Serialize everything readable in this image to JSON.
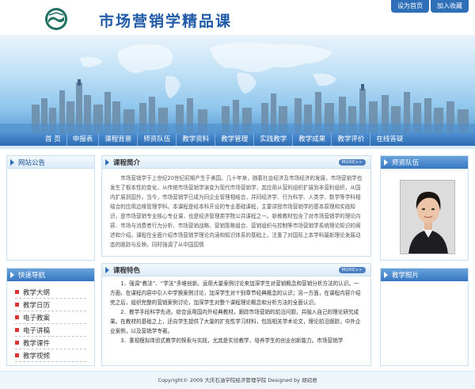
{
  "header": {
    "title": "市场营销学精品课",
    "links": [
      "设为首页",
      "加入收藏"
    ]
  },
  "nav": {
    "items": [
      "首 页",
      "申报表",
      "课程背景",
      "师资队伍",
      "教学资料",
      "教学管理",
      "实践教学",
      "教学成果",
      "教学评价",
      "在线答疑"
    ]
  },
  "left": {
    "announcement_title": "网站公告",
    "quicknav_title": "快速导航",
    "quicknav_items": [
      "教学大纲",
      "教学日历",
      "电子教案",
      "电子讲稿",
      "教学课件",
      "教学视频"
    ]
  },
  "main": {
    "intro_title": "课程简介",
    "intro_more": "MORE>>",
    "intro_text": "市场营销学于上世纪20世纪初期产生于美国。几十年来，随着社会经济及市场经济的发展，市场营销学也发生了根本性的变化，从传统市场营销学演变为现代市场营销学，其应用从营利组织扩展到非营利组织，从国内扩展到国外。当今，市场营销学已成为同企业管理相结合，并同经济学、行为科学、人类学、数学等学科相结合的应用边缘管理学科。本课程是经本科开设的专业基础课程，主要讲授市场营销学的基本原理和实践知识，是市场营销专业核心专业课，也是经济管理类学院公共课程之一。新教教材包含了对市场营销学的理论内容、市场与消费者行为分析、市场营销战略、营销策略组合、营销组织与控制等市场营销学系统理论知识的阐述和介绍。课程在全面介绍市场营销学理论内涵和知识体系的基础上，注重了对国际上本学科最新理论发展动态的跟踪与反映，同时强调了从中国国情",
    "feature_title": "课程特色",
    "feature_more": "MORE>>",
    "feature_paragraphs": [
      "1．强调“教法”、“学法”多维创新。运用大量案例讨论来加深学生对营销概念和营销分析方法的认识。一方面，在课程内容中引入中学换案例讨论，加深学生对个别章节经典概念的认识；另一方面，在课程内容介绍完之后，组织完整的营销案例讨论，加深学生对整个课程理论概念和分析方法的全面认识。",
      "2．教学手段科学先进。综合运用国内外经典教材，跟踪市场营销的前沿问题，并融入自己的理论研究成果。在教材的基础之上，还向学生提供了大量的扩充性学习材料，包括相关学术论文，理论前沿跟踪，中外企业案例，以及营销学专著。",
      "3．重视模拟体验式教学的探索与实践，尤其是实验教学，培养学生的创业创新能力。市场营销学"
    ]
  },
  "right": {
    "faculty_title": "师资队伍",
    "photo_title": "教学照片"
  },
  "footer": {
    "text": "Copyright© 2009 大庆石油学院经济管理学院 Designed by 胡绍君"
  },
  "colors": {
    "brand": "#1f5aa6",
    "nav": "#2c6bb2",
    "panel_border": "#c9dff2",
    "bullet": "#d33333"
  }
}
